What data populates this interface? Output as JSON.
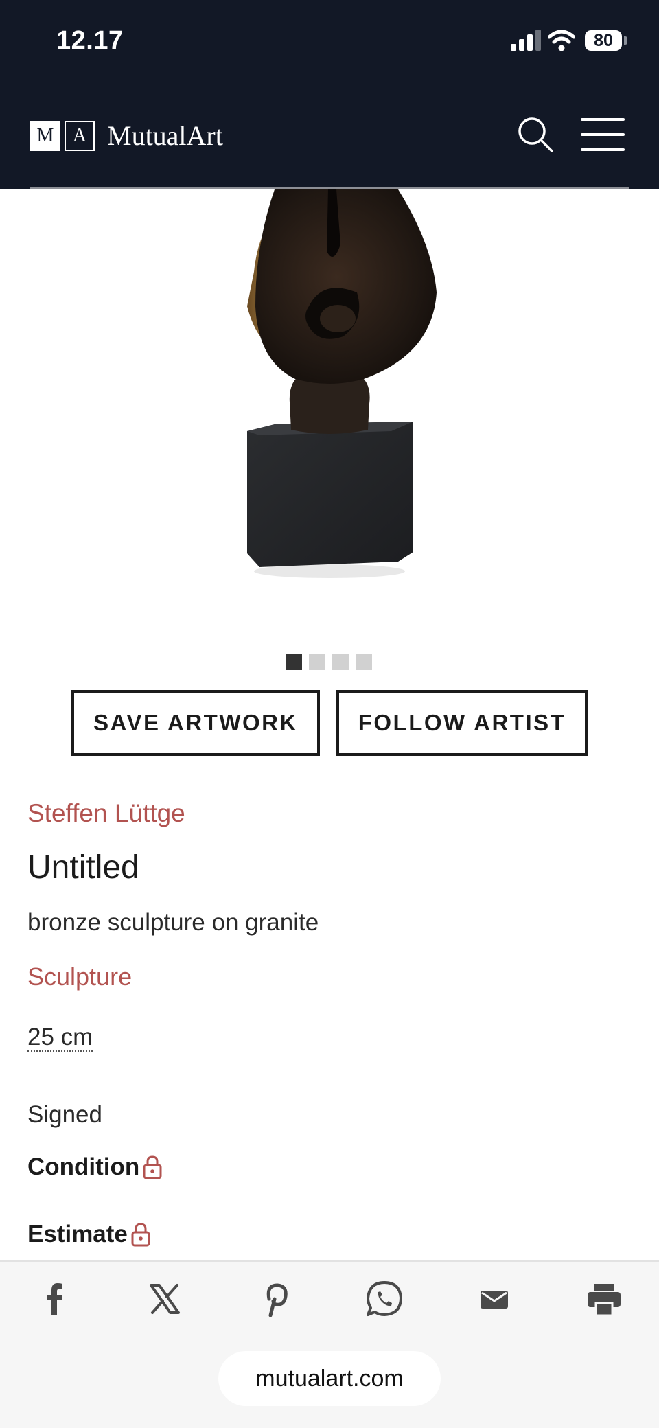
{
  "status_bar": {
    "time": "12.17",
    "battery": "80"
  },
  "header": {
    "logo_letters": [
      "M",
      "A"
    ],
    "logo_text": "MutualArt"
  },
  "carousel": {
    "total": 4,
    "current": 1
  },
  "actions": {
    "save_label": "SAVE ARTWORK",
    "follow_label": "FOLLOW ARTIST"
  },
  "artwork": {
    "artist": "Steffen Lüttge",
    "title": "Untitled",
    "medium": "bronze sculpture on granite",
    "category": "Sculpture",
    "size": "25 cm",
    "signed": "Signed",
    "condition_label": "Condition",
    "estimate_label": "Estimate"
  },
  "share": {
    "icons": [
      "facebook-icon",
      "x-icon",
      "pinterest-icon",
      "whatsapp-icon",
      "mail-icon",
      "print-icon"
    ]
  },
  "browser": {
    "url": "mutualart.com"
  },
  "colors": {
    "header_bg": "#121826",
    "accent": "#b25350",
    "text": "#1b1b1b"
  }
}
